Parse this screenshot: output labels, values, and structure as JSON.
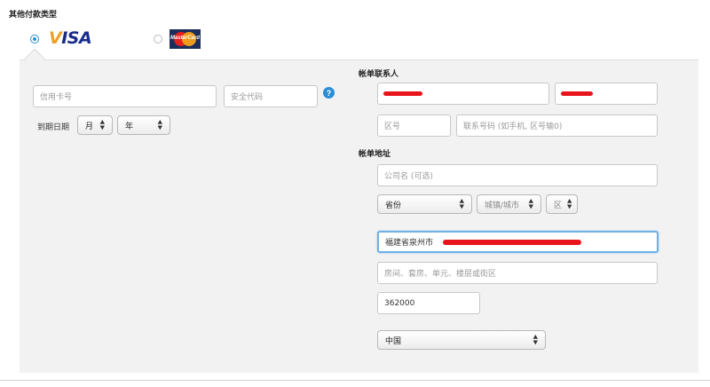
{
  "section_title": "其他付款类型",
  "payment_methods": [
    {
      "logo_text": "VISA",
      "icon": "visa-logo-icon",
      "selected": true
    },
    {
      "logo_text": "MasterCard",
      "icon": "mastercard-logo-icon",
      "selected": false
    }
  ],
  "card": {
    "number_placeholder": "信用卡号",
    "security_code_placeholder": "安全代码",
    "help_icon": "?",
    "expiry_label": "到期日期",
    "month_value": "月",
    "year_value": "年"
  },
  "billing_contact": {
    "heading": "帐单联系人",
    "area_code_placeholder": "区号",
    "phone_placeholder": "联系号码 (如手机, 区号输0)"
  },
  "billing_address": {
    "heading": "帐单地址",
    "company_placeholder": "公司名 (可选)",
    "province_value": "省份",
    "city_value": "城镇/城市",
    "district_value": "区",
    "street_value": "福建省泉州市",
    "apartment_placeholder": "房间、套房、单元、楼层或街区",
    "postal_code_value": "362000",
    "country_value": "中国"
  },
  "colors": {
    "accent": "#2a8ed6",
    "panel_bg": "#f2f2f2",
    "redaction": "#e8141c"
  }
}
